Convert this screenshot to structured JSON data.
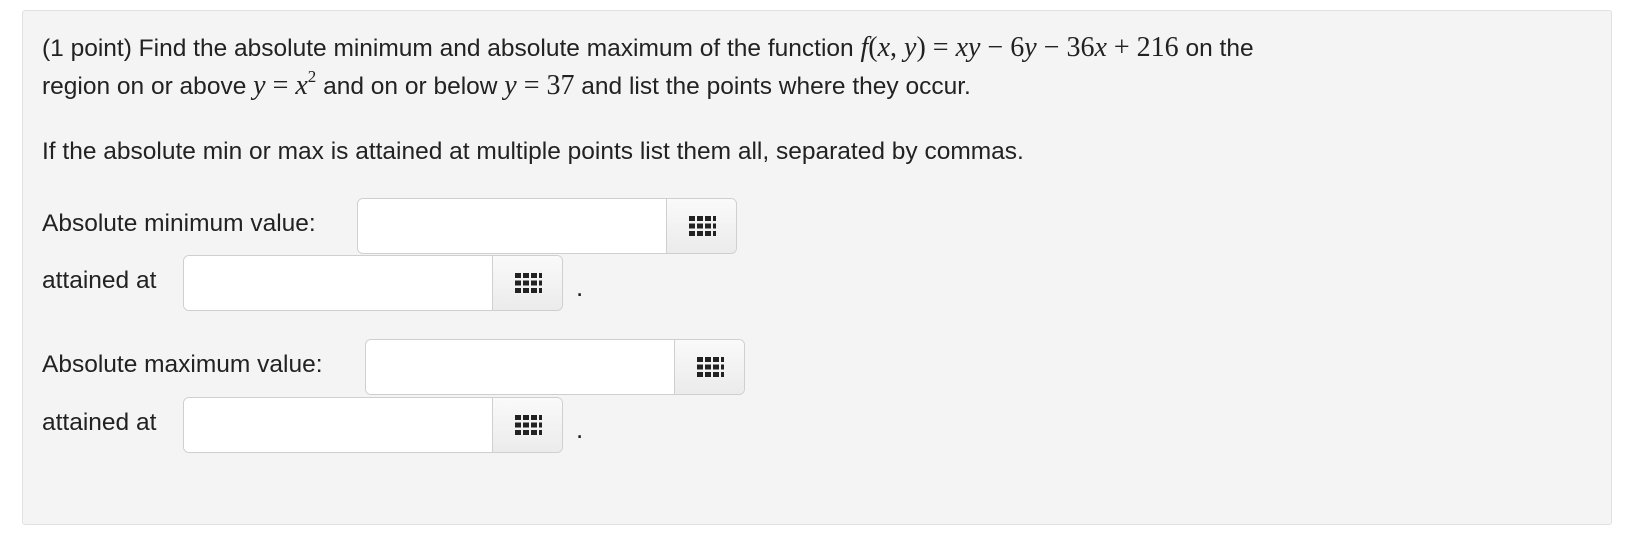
{
  "problem": {
    "line1_prefix": "(1 point) Find the absolute minimum and absolute maximum of the function ",
    "function_formula": "f(x, y) = xy − 6y − 36x + 216",
    "line1_suffix": " on the",
    "line2_prefix": "region on or above ",
    "region_lower": "y = x²",
    "line2_mid": " and on or below ",
    "region_upper": "y = 37",
    "line2_suffix": " and list the points where they occur.",
    "instruction": "If the absolute min or max is attained at multiple points list them all, separated by commas."
  },
  "answers": {
    "min_value_label": "Absolute minimum value:",
    "min_value": "",
    "min_points_label": "attained at",
    "min_points": "",
    "max_value_label": "Absolute maximum value:",
    "max_value": "",
    "max_points_label": "attained at",
    "max_points": "",
    "period": "."
  },
  "icons": {
    "equation_editor": "grid-icon"
  },
  "colors": {
    "panel_bg": "#f4f4f4",
    "panel_border": "#e1e1e1",
    "text": "#222222"
  }
}
